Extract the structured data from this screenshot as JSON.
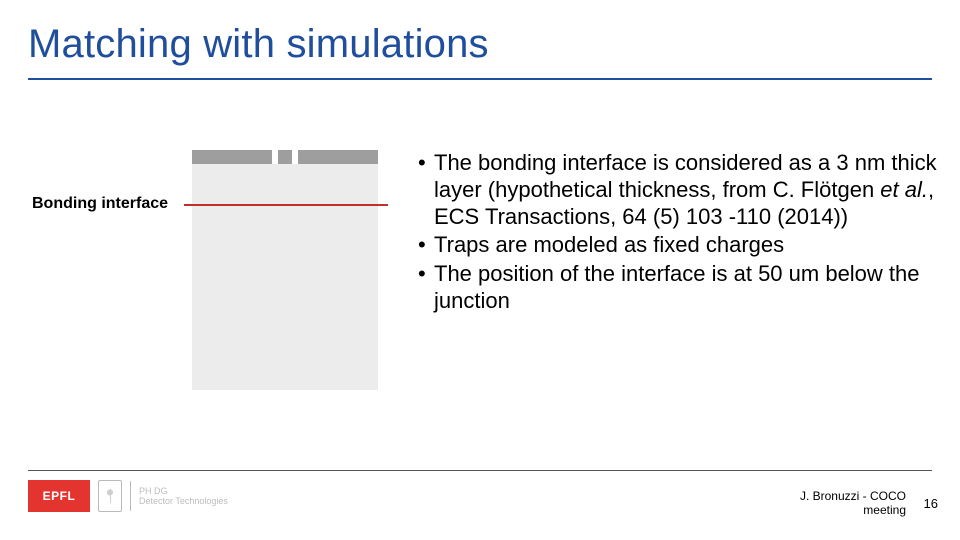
{
  "title": "Matching with simulations",
  "diagram": {
    "label": "Bonding interface"
  },
  "bullets": [
    {
      "text_html": "The bonding interface is considered as a 3 nm thick layer (hypothetical thickness, from C. Flötgen <em>et al.</em>, ECS Transactions, 64 (5) 103 -110 (2014))"
    },
    {
      "text_html": "Traps are modeled as fixed charges"
    },
    {
      "text_html": "The position of the interface is at 50 um below the junction"
    }
  ],
  "logo": {
    "brand": "EPFL",
    "sub1": "PH DG",
    "sub2": "Detector Technologies"
  },
  "footer": {
    "line1": "J. Bronuzzi -  COCO",
    "line2": "meeting",
    "page": "16"
  }
}
